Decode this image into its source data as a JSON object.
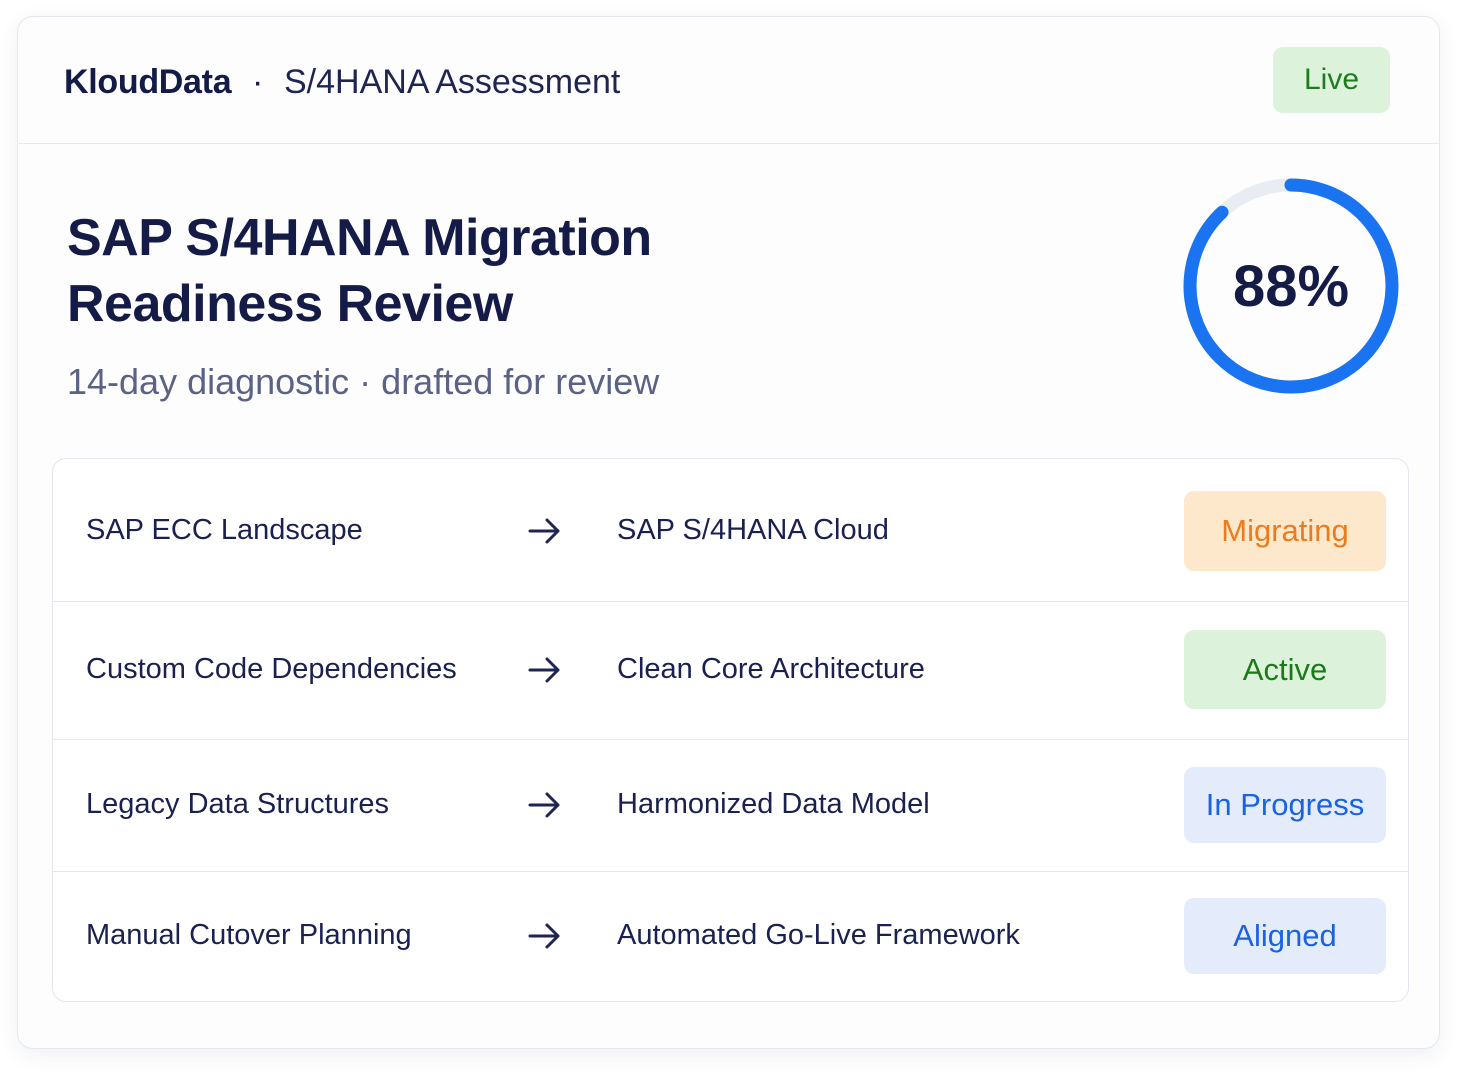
{
  "header": {
    "brand": "KloudData",
    "separator": "·",
    "section": "S/4HANA Assessment",
    "live_badge": "Live"
  },
  "hero": {
    "title_line1": "SAP S/4HANA Migration",
    "title_line2": "Readiness Review",
    "subtitle": "14-day diagnostic · drafted for review"
  },
  "readiness": {
    "value": 88,
    "label": "88%",
    "ring_color": "#1a73f0",
    "track_color": "#e9ecf2"
  },
  "migration_rows": [
    {
      "from": "SAP ECC Landscape",
      "to": "SAP S/4HANA Cloud",
      "status": "Migrating",
      "arrow_icon": "arrow-right-icon"
    },
    {
      "from": "Custom Code Dependencies",
      "to": "Clean Core Architecture",
      "status": "Active",
      "arrow_icon": "arrow-right-icon"
    },
    {
      "from": "Legacy Data Structures",
      "to": "Harmonized Data Model",
      "status": "In Progress",
      "arrow_icon": "arrow-right-icon"
    },
    {
      "from": "Manual Cutover Planning",
      "to": "Automated Go-Live Framework",
      "status": "Aligned",
      "arrow_icon": "arrow-right-icon"
    }
  ],
  "status_colors": {
    "Migrating": {
      "bg": "#fde8cc",
      "fg": "#ee7b1b"
    },
    "Active": {
      "bg": "#dcf2da",
      "fg": "#1d7a1b"
    },
    "In Progress": {
      "bg": "#e4ecfb",
      "fg": "#1a62e0"
    },
    "Aligned": {
      "bg": "#e4ecfb",
      "fg": "#1a62e0"
    },
    "Live": {
      "bg": "#dcf2da",
      "fg": "#207a1e"
    }
  }
}
